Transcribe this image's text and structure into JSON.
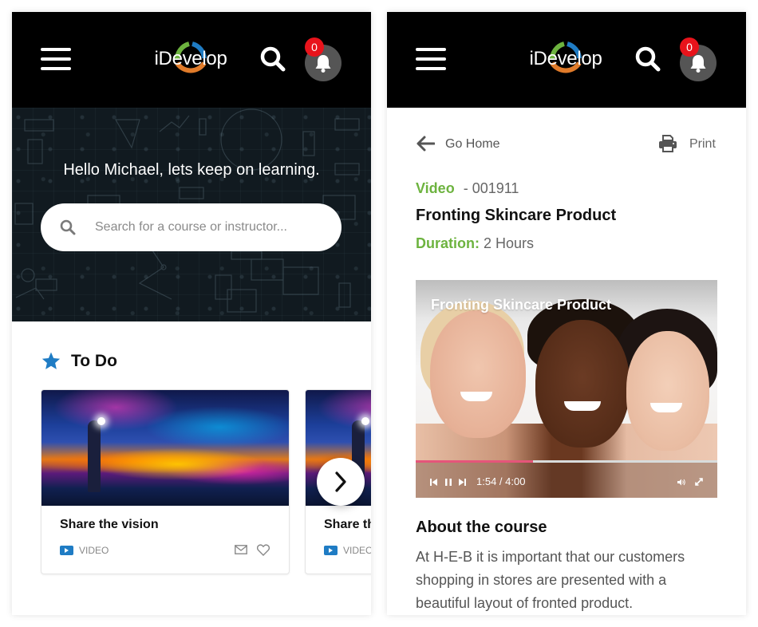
{
  "app": {
    "brand": "iDevelop",
    "brand_colors": {
      "green": "#6db33f",
      "blue": "#1f7cc4",
      "orange": "#e07b2a"
    },
    "notification_count": "0",
    "icons": {
      "menu": "hamburger-icon",
      "search": "search-icon",
      "notifications": "bell-icon"
    }
  },
  "home": {
    "greeting": "Hello Michael, lets keep on learning.",
    "search": {
      "placeholder": "Search for a course or instructor...",
      "value": ""
    },
    "todo": {
      "title": "To Do",
      "icon": "star-icon",
      "accent": "#1f7cc4",
      "cards": [
        {
          "title": "Share the vision",
          "type": "VIDEO",
          "actions": [
            "mail-icon",
            "heart-icon"
          ]
        },
        {
          "title": "Share the vision",
          "type": "VIDEO"
        }
      ],
      "next_icon": "chevron-right-icon"
    }
  },
  "detail": {
    "back_label": "Go Home",
    "print_label": "Print",
    "type": "Video",
    "code": "- 001911",
    "title": "Fronting Skincare Product",
    "duration_label": "Duration:",
    "duration_value": "2 Hours",
    "accent": "#6db33f",
    "video": {
      "overlay_title": "Fronting Skincare Product",
      "time": "1:54 / 4:00",
      "progress_percent": 39,
      "progress_color": "#e5557a"
    },
    "about": {
      "title": "About the course",
      "text": "At H-E-B it is important that our customers shopping in stores are presented with a beautiful layout of fronted product."
    }
  }
}
